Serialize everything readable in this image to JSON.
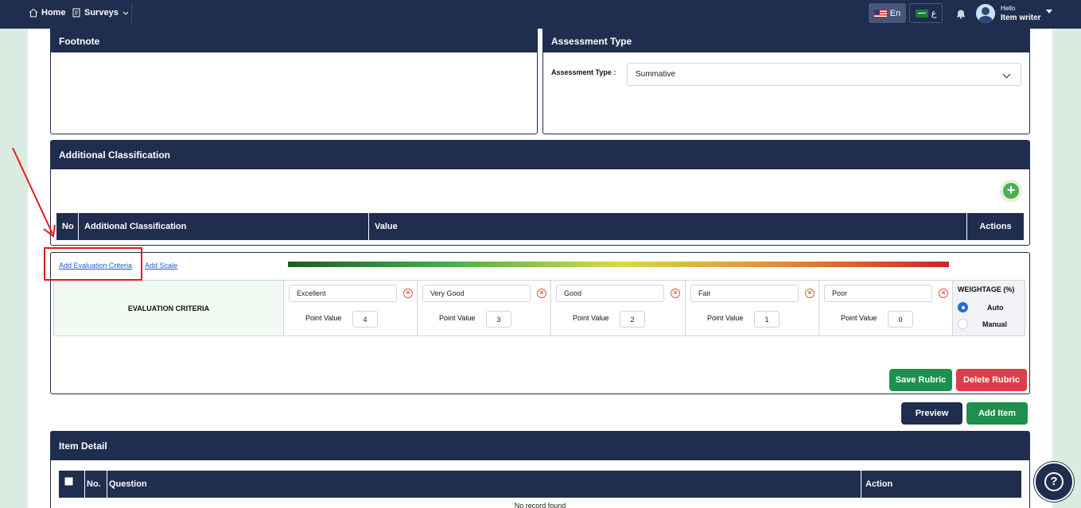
{
  "topbar": {
    "home_label": "Home",
    "surveys_label": "Surveys",
    "lang_en": "En",
    "lang_ar": "ع",
    "user_greeting": "Hello",
    "user_role": "Item writer"
  },
  "footnote": {
    "title": "Footnote"
  },
  "assessment_type": {
    "title": "Assessment Type",
    "field_label": "Assessment Type :",
    "selected_value": "Summative"
  },
  "additional_classification": {
    "title": "Additional Classification",
    "columns": [
      "No",
      "Additional Classification",
      "Value",
      "Actions"
    ]
  },
  "rubric": {
    "add_evaluation_criteria": "Add Evaluation Criteria",
    "add_scale": "Add Scale",
    "criteria_label": "EVALUATION CRITERIA",
    "point_value_label": "Point Value",
    "levels": [
      {
        "name": "Excellent",
        "points": "4"
      },
      {
        "name": "Very Good",
        "points": "3"
      },
      {
        "name": "Good",
        "points": "2"
      },
      {
        "name": "Fair",
        "points": "1"
      },
      {
        "name": "Poor",
        "points": "0"
      }
    ],
    "weightage_title": "WEIGHTAGE (%)",
    "weightage_options": [
      "Auto",
      "Manual"
    ],
    "weightage_selected": "Auto",
    "save_label": "Save Rubric",
    "delete_label": "Delete Rubric"
  },
  "actions": {
    "preview_label": "Preview",
    "add_item_label": "Add Item"
  },
  "item_detail": {
    "title": "Item Detail",
    "columns": [
      "No.",
      "Question",
      "Action"
    ],
    "empty_text": "No record found"
  },
  "colors": {
    "navy": "#1f2d4e",
    "green": "#1f8f4f",
    "red": "#dd3d4d",
    "link": "#1f5bd6"
  }
}
